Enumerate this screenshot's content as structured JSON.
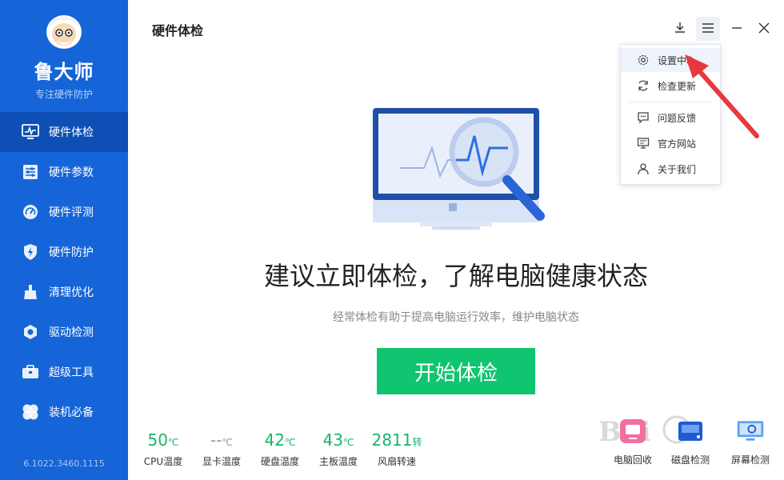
{
  "app": {
    "name": "鲁大师",
    "subtitle": "专注硬件防护",
    "version": "6.1022.3460.1115"
  },
  "header": {
    "title": "硬件体检"
  },
  "sidebar": {
    "items": [
      {
        "label": "硬件体检",
        "icon": "pulse-monitor-icon",
        "active": true
      },
      {
        "label": "硬件参数",
        "icon": "sliders-icon",
        "active": false
      },
      {
        "label": "硬件评测",
        "icon": "gauge-icon",
        "active": false
      },
      {
        "label": "硬件防护",
        "icon": "shield-bolt-icon",
        "active": false
      },
      {
        "label": "清理优化",
        "icon": "broom-icon",
        "active": false
      },
      {
        "label": "驱动检测",
        "icon": "hexagon-gear-icon",
        "active": false
      },
      {
        "label": "超级工具",
        "icon": "toolbox-icon",
        "active": false
      },
      {
        "label": "装机必备",
        "icon": "clover-icon",
        "active": false
      }
    ]
  },
  "menu": {
    "items": [
      {
        "label": "设置中心",
        "icon": "gear-icon"
      },
      {
        "label": "检查更新",
        "icon": "refresh-icon"
      },
      {
        "label": "问题反馈",
        "icon": "chat-icon"
      },
      {
        "label": "官方网站",
        "icon": "monitor-icon"
      },
      {
        "label": "关于我们",
        "icon": "user-icon"
      }
    ]
  },
  "main": {
    "headline": "建议立即体检，了解电脑健康状态",
    "subtext": "经常体检有助于提高电脑运行效率，维护电脑状态",
    "start_button": "开始体检"
  },
  "stats": [
    {
      "value": "50",
      "unit": "℃",
      "label": "CPU温度"
    },
    {
      "value": "--",
      "unit": "℃",
      "label": "显卡温度"
    },
    {
      "value": "42",
      "unit": "℃",
      "label": "硬盘温度"
    },
    {
      "value": "43",
      "unit": "℃",
      "label": "主板温度"
    },
    {
      "value": "2811",
      "unit": "转",
      "label": "风扇转速"
    }
  ],
  "tools": [
    {
      "label": "电脑回收",
      "icon": "recycle-icon"
    },
    {
      "label": "磁盘检测",
      "icon": "disk-icon"
    },
    {
      "label": "屏幕检测",
      "icon": "screen-check-icon"
    }
  ],
  "colors": {
    "sidebar": "#1565d8",
    "active": "#0d4fb5",
    "start": "#10c570",
    "stat": "#1ab36a",
    "arrow": "#e8383d"
  }
}
